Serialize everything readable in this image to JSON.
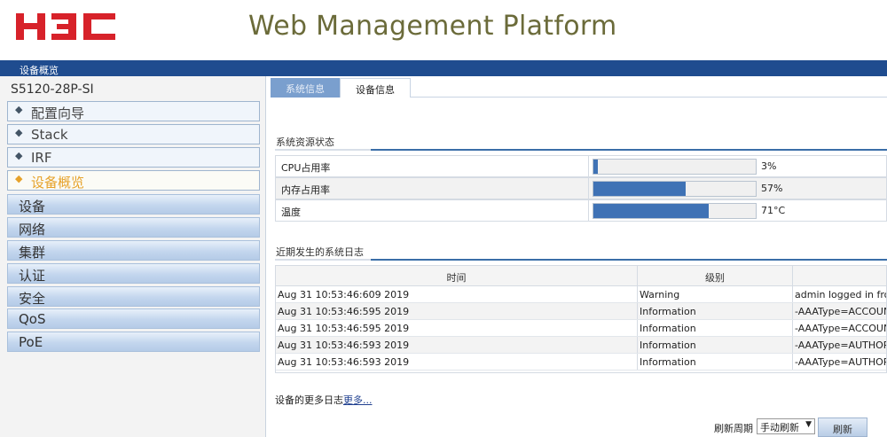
{
  "header": {
    "logo_text": "H3C",
    "platform_title": "Web Management Platform"
  },
  "top_bar": {
    "breadcrumb": "设备概览"
  },
  "sidebar": {
    "device_model": "S5120-28P-SI",
    "items": [
      {
        "label": "配置向导"
      },
      {
        "label": "Stack"
      },
      {
        "label": "IRF"
      },
      {
        "label": "设备概览"
      }
    ],
    "categories": [
      {
        "label": "设备"
      },
      {
        "label": "网络"
      },
      {
        "label": "集群"
      },
      {
        "label": "认证"
      },
      {
        "label": "安全"
      },
      {
        "label": "QoS"
      },
      {
        "label": "PoE"
      }
    ],
    "colors": {
      "active_item": "#e6a22a",
      "category_bg": "#c3d6ee"
    }
  },
  "tabs": [
    {
      "label": "系统信息"
    },
    {
      "label": "设备信息"
    }
  ],
  "resources": {
    "title": "系统资源状态",
    "rows": [
      {
        "label": "CPU占用率",
        "percent": 3,
        "value_text": "3%"
      },
      {
        "label": "内存占用率",
        "percent": 57,
        "value_text": "57%"
      },
      {
        "label": "温度",
        "percent": 71,
        "value_text": "71°C"
      }
    ]
  },
  "logs": {
    "title": "近期发生的系统日志",
    "headers": {
      "time": "时间",
      "level": "级别",
      "desc": ""
    },
    "rows": [
      {
        "time": "Aug 31 10:53:46:609 2019",
        "level": "Warning",
        "desc": "admin logged in from"
      },
      {
        "time": "Aug 31 10:53:46:595 2019",
        "level": "Information",
        "desc": "-AAAType=ACCOUNT"
      },
      {
        "time": "Aug 31 10:53:46:595 2019",
        "level": "Information",
        "desc": "-AAAType=ACCOUNT"
      },
      {
        "time": "Aug 31 10:53:46:593 2019",
        "level": "Information",
        "desc": "-AAAType=AUTHOR-A"
      },
      {
        "time": "Aug 31 10:53:46:593 2019",
        "level": "Information",
        "desc": "-AAAType=AUTHOR-A"
      }
    ],
    "more_prefix": "设备的更多日志",
    "more_link": "更多..."
  },
  "refresh": {
    "label": "刷新周期",
    "selected": "手动刷新",
    "button": "刷新"
  },
  "icons": {
    "nav_bullet": "diamond-icon",
    "select_arrow": "dropdown-arrow-icon"
  }
}
